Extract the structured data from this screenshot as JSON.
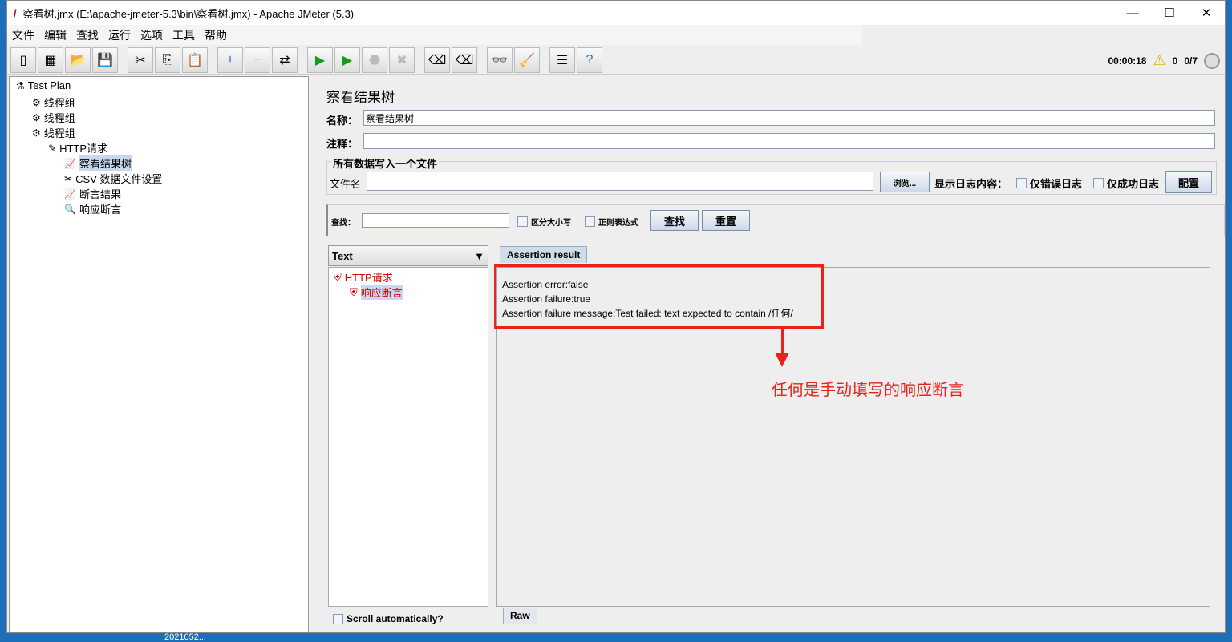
{
  "window": {
    "title": "察看树.jmx (E:\\apache-jmeter-5.3\\bin\\察看树.jmx) - Apache JMeter (5.3)",
    "minimize": "—",
    "maximize": "☐",
    "close": "✕"
  },
  "menu": [
    "文件",
    "编辑",
    "查找",
    "运行",
    "选项",
    "工具",
    "帮助"
  ],
  "toolbar": {
    "icons": [
      "new-icon",
      "templates-icon",
      "open-icon",
      "save-icon",
      "cut-icon",
      "copy-icon",
      "paste-icon",
      "expand-icon",
      "collapse-icon",
      "toggle-icon",
      "start-icon",
      "start-no-pause-icon",
      "stop-icon",
      "shutdown-icon",
      "clear-icon",
      "clear-all-icon",
      "search-icon",
      "reset-search-icon",
      "function-helper-icon",
      "help-icon"
    ]
  },
  "status": {
    "elapsed": "00:00:18",
    "warnings": "0",
    "threads": "0/7"
  },
  "tree": [
    {
      "label": "Test Plan",
      "depth": 0
    },
    {
      "label": "线程组",
      "depth": 1
    },
    {
      "label": "线程组",
      "depth": 1
    },
    {
      "label": "线程组",
      "depth": 1
    },
    {
      "label": "HTTP请求",
      "depth": 2
    },
    {
      "label": "察看结果树",
      "depth": 3,
      "selected": true
    },
    {
      "label": "CSV 数据文件设置",
      "depth": 3
    },
    {
      "label": "断言结果",
      "depth": 3
    },
    {
      "label": "响应断言",
      "depth": 3
    }
  ],
  "main": {
    "title": "察看结果树",
    "name_label": "名称：",
    "name_value": "察看结果树",
    "comment_label": "注释：",
    "comment_value": "",
    "file_section": "所有数据写入一个文件",
    "filename_label": "文件名",
    "filename_value": "",
    "browse": "浏览...",
    "log_label": "显示日志内容：",
    "errors_only": "仅错误日志",
    "success_only": "仅成功日志",
    "configure": "配置",
    "search_label": "查找：",
    "search_value": "",
    "case_sensitive": "区分大小写",
    "regex": "正则表达式",
    "find": "查找",
    "reset": "重置",
    "renderer": "Text",
    "results": [
      {
        "label": "HTTP请求",
        "depth": 0
      },
      {
        "label": "响应断言",
        "depth": 1
      }
    ],
    "scroll_auto": "Scroll automatically?",
    "tab": "Assertion result",
    "raw_tab": "Raw",
    "result_lines": [
      "Assertion error:false",
      "Assertion failure:true",
      "Assertion failure message:Test failed: text expected to contain /任何/"
    ],
    "annotation": "任何是手动填写的响应断言"
  },
  "desktop": {
    "label": "2021052..."
  },
  "colors": {
    "annotation": "#e8231c",
    "fail_text": "#d00000"
  }
}
